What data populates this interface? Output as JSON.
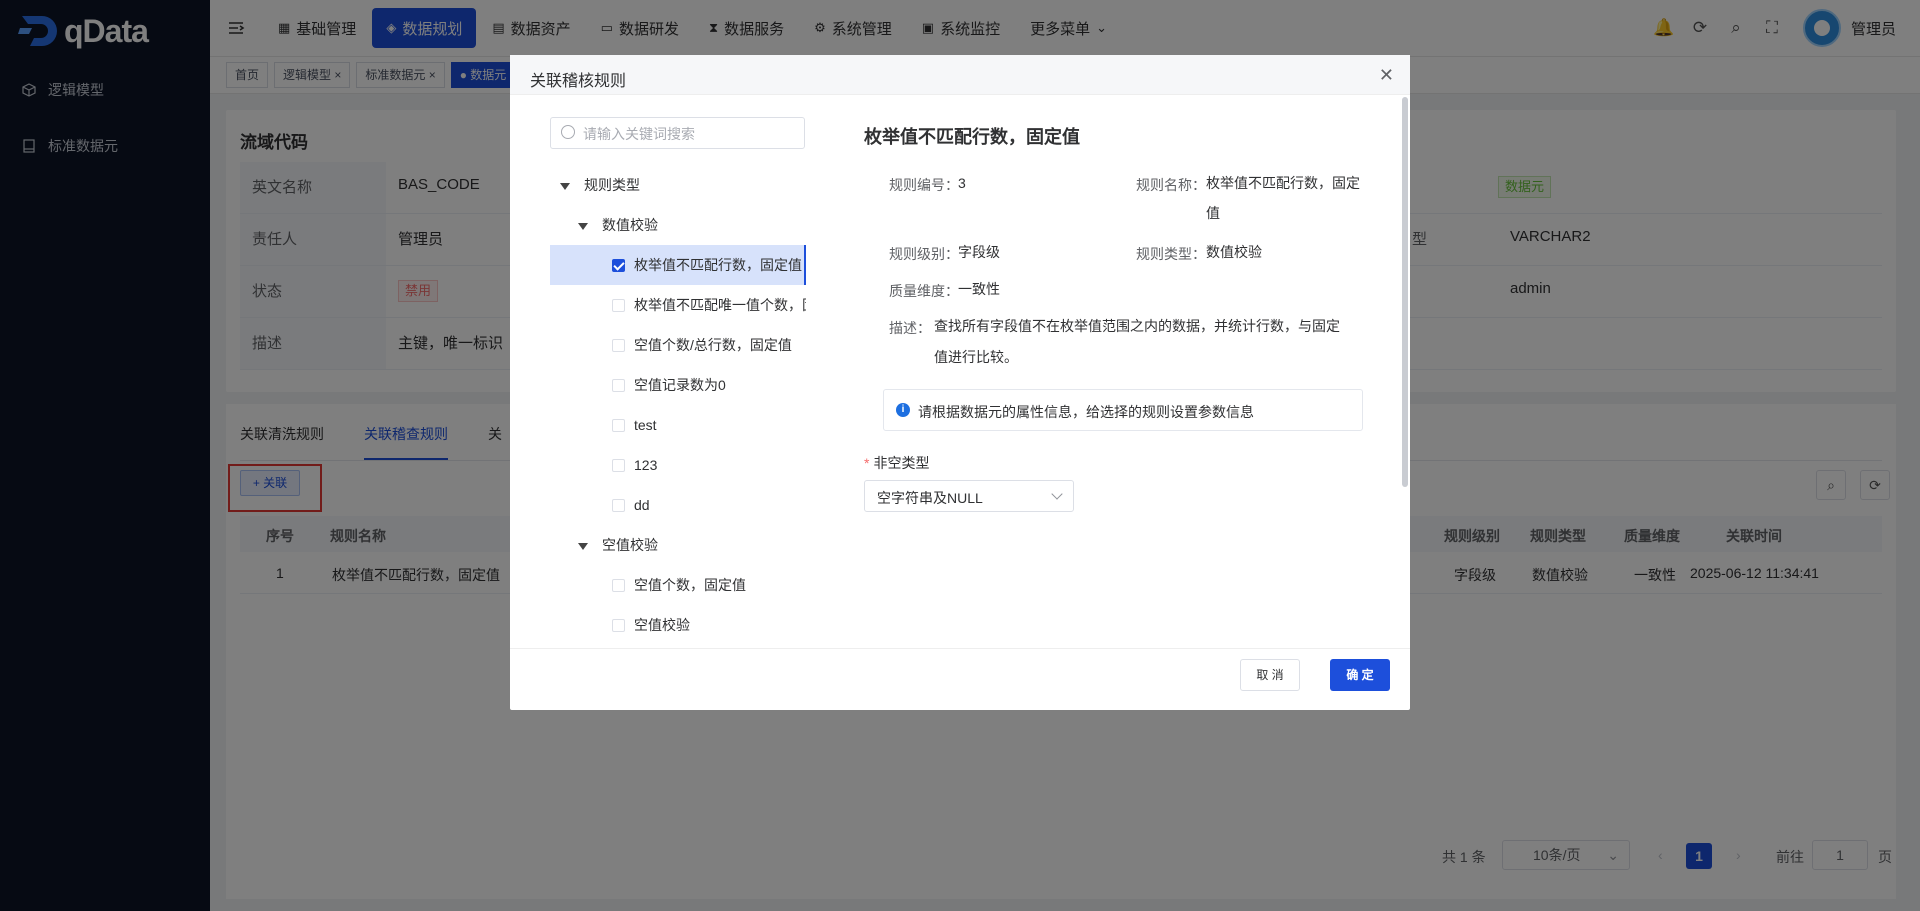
{
  "brand": {
    "name": "qData"
  },
  "sidebar": {
    "items": [
      {
        "label": "逻辑模型",
        "icon": "cube-icon"
      },
      {
        "label": "标准数据元",
        "icon": "book-icon"
      }
    ]
  },
  "topnav": {
    "items": [
      {
        "label": "基础管理",
        "icon": "grid-icon"
      },
      {
        "label": "数据规划",
        "icon": "layers-icon",
        "active": true
      },
      {
        "label": "数据资产",
        "icon": "folder-icon"
      },
      {
        "label": "数据研发",
        "icon": "monitor-icon"
      },
      {
        "label": "数据服务",
        "icon": "hourglass-icon"
      },
      {
        "label": "系统管理",
        "icon": "gear-icon"
      },
      {
        "label": "系统监控",
        "icon": "screen-icon"
      },
      {
        "label": "更多菜单",
        "icon": "chevron-down-icon"
      }
    ],
    "user": "管理员"
  },
  "tags": [
    {
      "label": "首页"
    },
    {
      "label": "逻辑模型 ×"
    },
    {
      "label": "标准数据元 ×"
    },
    {
      "label": "● 数据元",
      "active": true
    }
  ],
  "info": {
    "title": "流域代码",
    "rows": [
      {
        "label": "英文名称",
        "value": "BAS_CODE"
      },
      {
        "label": "责任人",
        "value": "管理员"
      },
      {
        "label": "状态",
        "value": "禁用"
      },
      {
        "label": "描述",
        "value": "主键，唯一标识"
      }
    ],
    "right": [
      {
        "label": "型",
        "value": "VARCHAR2"
      },
      {
        "value": "admin"
      }
    ],
    "type_badge": "数据元"
  },
  "tabs": [
    "关联清洗规则",
    "关联稽查规则",
    "关"
  ],
  "add_button": "+ 关联",
  "table": {
    "headers": [
      "序号",
      "规则名称",
      "规则级别",
      "规则类型",
      "质量维度",
      "关联时间"
    ],
    "rows": [
      [
        "1",
        "枚举值不匹配行数，固定值",
        "字段级",
        "数值校验",
        "一致性",
        "2025-06-12 11:34:41"
      ]
    ]
  },
  "pagination": {
    "total": "共 1 条",
    "page_size": "10条/页",
    "current": "1",
    "goto_label": "前往",
    "goto_value": "1",
    "page_suffix": "页"
  },
  "dialog": {
    "title": "关联稽核规则",
    "search_placeholder": "请输入关键词搜索",
    "tree": [
      {
        "label": "规则类型",
        "level": 0,
        "type": "folder"
      },
      {
        "label": "数值校验",
        "level": 1,
        "type": "folder"
      },
      {
        "label": "枚举值不匹配行数，固定值",
        "level": 2,
        "checked": true,
        "selected": true
      },
      {
        "label": "枚举值不匹配唯一值个数，固",
        "level": 2
      },
      {
        "label": "空值个数/总行数，固定值",
        "level": 2
      },
      {
        "label": "空值记录数为0",
        "level": 2
      },
      {
        "label": "test",
        "level": 2
      },
      {
        "label": "123",
        "level": 2
      },
      {
        "label": "dd",
        "level": 2
      },
      {
        "label": "空值校验",
        "level": 1,
        "type": "folder"
      },
      {
        "label": "空值个数，固定值",
        "level": 2
      },
      {
        "label": "空值校验",
        "level": 2
      }
    ],
    "detail": {
      "title": "枚举值不匹配行数，固定值",
      "rule_no_label": "规则编号：",
      "rule_no": "3",
      "rule_name_label": "规则名称：",
      "rule_name_l1": "枚举值不匹配行数，固定",
      "rule_name_l2": "值",
      "rule_level_label": "规则级别：",
      "rule_level": "字段级",
      "rule_type_label": "规则类型：",
      "rule_type": "数值校验",
      "quality_label": "质量维度：",
      "quality": "一致性",
      "desc_label": "描述：",
      "desc_l1": "查找所有字段值不在枚举值范围之内的数据，并统计行数，与固定",
      "desc_l2": "值进行比较。",
      "notice": "请根据数据元的属性信息，给选择的规则设置参数信息",
      "field_label": "非空类型",
      "field_value": "空字符串及NULL"
    },
    "cancel": "取 消",
    "ok": "确 定"
  }
}
